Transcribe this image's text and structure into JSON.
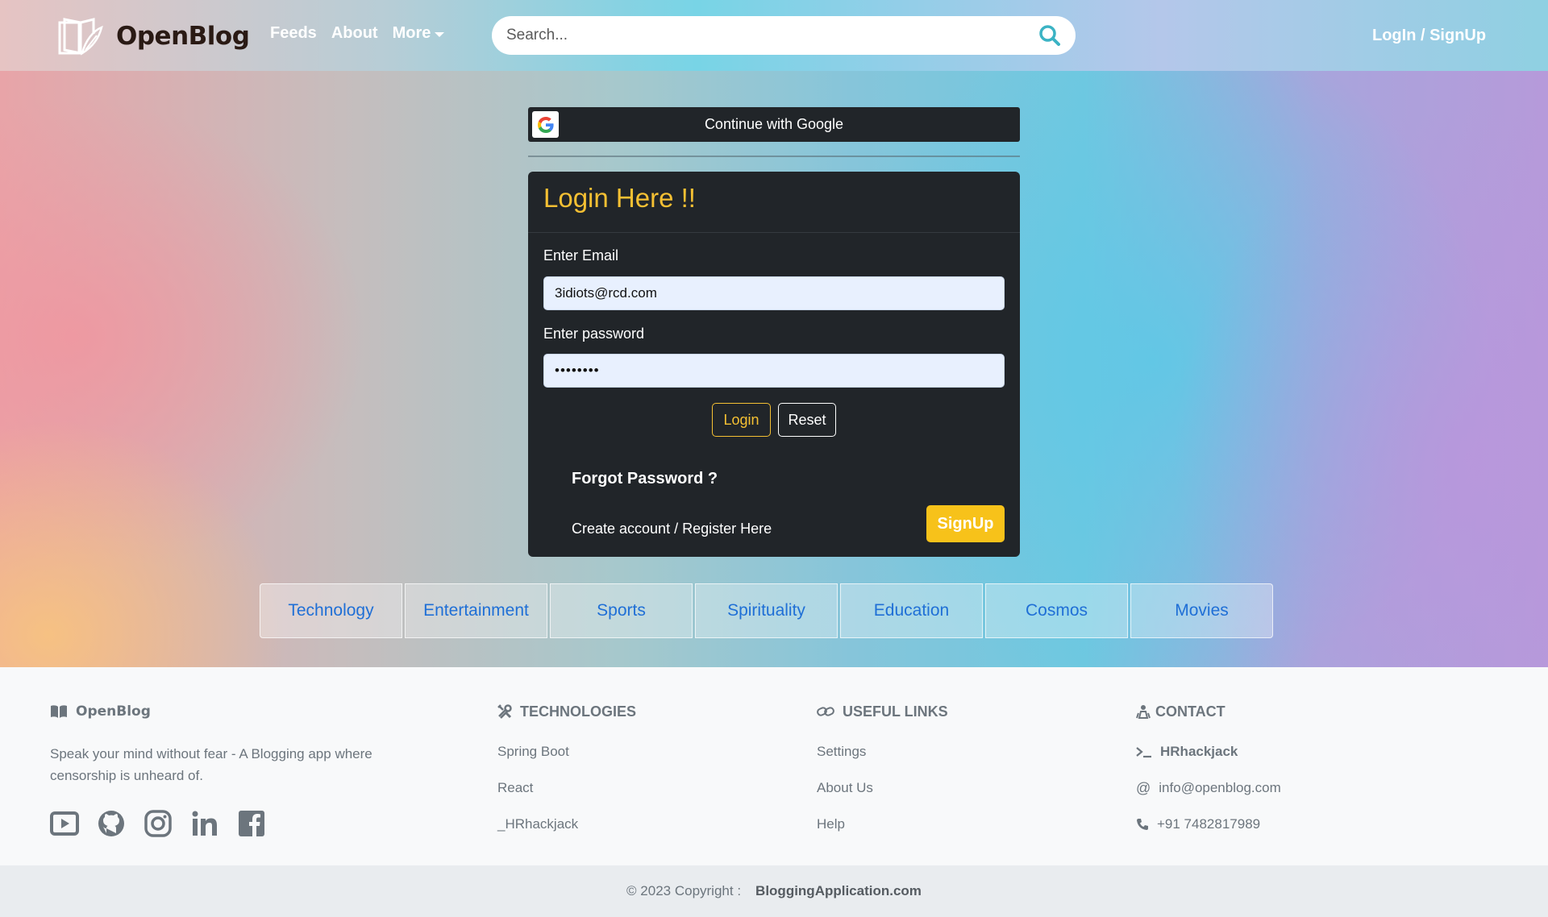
{
  "navbar": {
    "brand": "OpenBlog",
    "links": {
      "feeds": "Feeds",
      "about": "About",
      "more": "More"
    },
    "search": {
      "placeholder": "Search...",
      "value": ""
    },
    "auth_link": "LogIn / SignUp"
  },
  "login": {
    "google_button": "Continue with Google",
    "title": "Login Here !!",
    "email_label": "Enter Email",
    "email_value": "3idiots@rcd.com",
    "password_label": "Enter password",
    "password_value": "••••••••",
    "login_button": "Login",
    "reset_button": "Reset",
    "forgot_link": "Forgot Password ?",
    "create_text": "Create account / Register Here",
    "signup_button": "SignUp"
  },
  "categories": [
    "Technology",
    "Entertainment",
    "Sports",
    "Spirituality",
    "Education",
    "Cosmos",
    "Movies"
  ],
  "footer": {
    "brand": "OpenBlog",
    "description": "Speak your mind without fear - A Blogging app where censorship is unheard of.",
    "technologies": {
      "title": "TECHNOLOGIES",
      "items": [
        "Spring Boot",
        "React",
        "_HRhackjack"
      ]
    },
    "useful_links": {
      "title": "USEFUL LINKS",
      "items": [
        "Settings",
        "About Us",
        "Help"
      ]
    },
    "contact": {
      "title": "CONTACT",
      "handle": "HRhackjack",
      "email": "info@openblog.com",
      "phone": "+91 7482817989"
    },
    "copyright_prefix": "© 2023 Copyright :",
    "copyright_site": "BloggingApplication.com"
  },
  "colors": {
    "accent": "#f5c033",
    "card_bg": "#212529",
    "link_blue": "#1f6fd6"
  },
  "icons": [
    "book-feather-logo-icon",
    "search-icon",
    "google-icon",
    "open-book-icon",
    "tools-icon",
    "link-icon",
    "people-icon",
    "terminal-icon",
    "at-icon",
    "phone-icon",
    "youtube-icon",
    "github-icon",
    "instagram-icon",
    "linkedin-icon",
    "facebook-icon"
  ]
}
